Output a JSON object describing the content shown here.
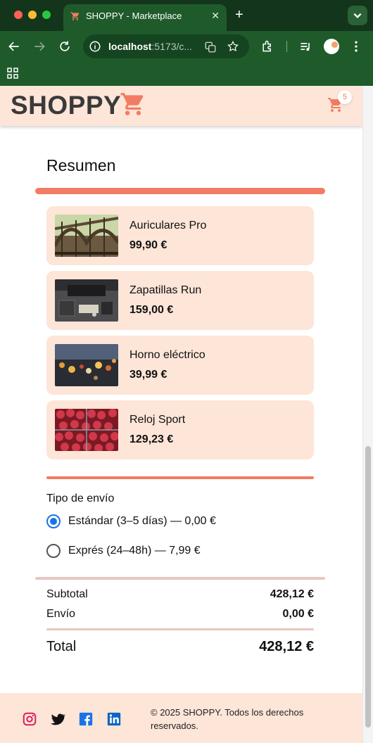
{
  "browser": {
    "tab_title": "SHOPPY - Marketplace",
    "url_host": "localhost",
    "url_rest": ":5173/c..."
  },
  "header": {
    "logo": "SHOPPY",
    "cart_count": "5"
  },
  "summary": {
    "title": "Resumen",
    "items": [
      {
        "name": "Auriculares Pro",
        "price": "99,90 €",
        "image": "bridge-photo"
      },
      {
        "name": "Zapatillas Run",
        "price": "159,00 €",
        "image": "desk-photo"
      },
      {
        "name": "Horno eléctrico",
        "price": "39,99 €",
        "image": "bokeh-lights-photo"
      },
      {
        "name": "Reloj Sport",
        "price": "129,23 €",
        "image": "strawberries-photo"
      }
    ]
  },
  "shipping": {
    "label": "Tipo de envío",
    "options": [
      {
        "label": "Estándar (3–5 días) — 0,00 €",
        "selected": true
      },
      {
        "label": "Exprés (24–48h) — 7,99 €",
        "selected": false
      }
    ]
  },
  "totals": {
    "subtotal_label": "Subtotal",
    "subtotal_value": "428,12 €",
    "shipping_label": "Envío",
    "shipping_value": "0,00 €",
    "total_label": "Total",
    "total_value": "428,12 €"
  },
  "footer": {
    "copyright": "© 2025 SHOPPY. Todos los derechos reservados.",
    "social": [
      "instagram-icon",
      "twitter-icon",
      "facebook-icon",
      "linkedin-icon"
    ]
  },
  "colors": {
    "accent": "#f27c63",
    "card_bg": "#fde5d8",
    "chrome_dark": "#13351b",
    "chrome": "#1f5a2b",
    "radio": "#1a73e8"
  }
}
